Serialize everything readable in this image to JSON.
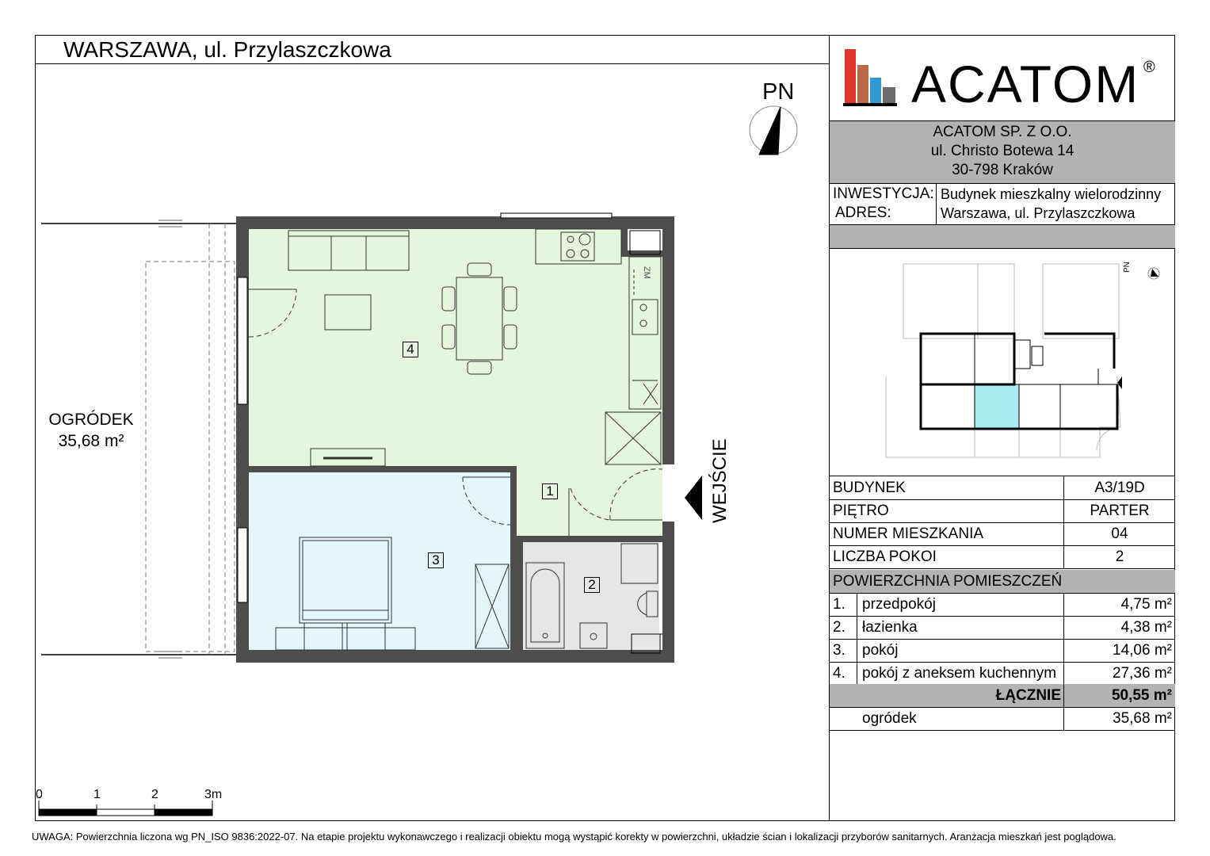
{
  "header": {
    "title": "WARSZAWA, ul. Przylaszczkowa"
  },
  "logo": {
    "name": "ACATOM",
    "registered": "®"
  },
  "company": {
    "line1": "ACATOM SP. Z O.O.",
    "line2": "ul. Christo Botewa 14",
    "line3": "30-798 Kraków"
  },
  "investment": {
    "label_investment": "INWESTYCJA:",
    "label_address": "ADRES:",
    "value_investment": "Budynek mieszkalny wielorodzinny",
    "value_address": "Warszawa, ul. Przylaszczkowa"
  },
  "north_label": "PN",
  "mini_north_label": "PN",
  "entry_label": "WEJŚCIE",
  "garden": {
    "label": "OGRÓDEK",
    "area": "35,68 m²"
  },
  "rooms_on_plan": [
    "4",
    "1",
    "3",
    "2"
  ],
  "zm_label": "ZM",
  "details": [
    {
      "label": "BUDYNEK",
      "value": "A3/19D"
    },
    {
      "label": "PIĘTRO",
      "value": "PARTER"
    },
    {
      "label": "NUMER MIESZKANIA",
      "value": "04"
    },
    {
      "label": "LICZBA POKOI",
      "value": "2"
    }
  ],
  "areas_header": "POWIERZCHNIA POMIESZCZEŃ",
  "areas": [
    {
      "num": "1.",
      "name": "przedpokój",
      "area": "4,75 m²"
    },
    {
      "num": "2.",
      "name": "łazienka",
      "area": "4,38 m²"
    },
    {
      "num": "3.",
      "name": "pokój",
      "area": "14,06 m²"
    },
    {
      "num": "4.",
      "name": "pokój z aneksem kuchennym",
      "area": "27,36 m²"
    }
  ],
  "total": {
    "label": "ŁĄCZNIE",
    "area": "50,55 m²"
  },
  "garden_row": {
    "name": "ogródek",
    "area": "35,68 m²"
  },
  "scale": {
    "t0": "0",
    "t1": "1",
    "t2": "2",
    "t3": "3m"
  },
  "footer": "UWAGA: Powierzchnia liczona wg PN_ISO 9836:2022-07. Na etapie projektu wykonawczego i realizacji obiektu mogą wystąpić korekty w powierzchni, układzie ścian i lokalizacji przyborów sanitarnych. Aranżacja mieszkań jest poglądowa.",
  "colors": {
    "living_room": "#e6f5dd",
    "bedroom": "#e3f6f8",
    "bathroom": "#e6e6e6",
    "wall": "#4d4d4d",
    "panel_grey": "#b3b3b3",
    "highlight": "#a8ecf2",
    "logo_red": "#e0352b",
    "logo_brown": "#b86a4a",
    "logo_blue": "#2f9ad6",
    "logo_grey": "#6d6d6d"
  }
}
